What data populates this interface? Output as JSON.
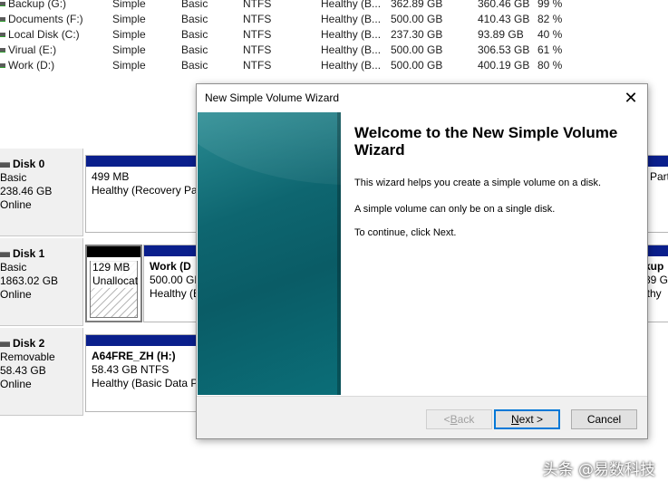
{
  "volumes": [
    {
      "name": "Backup (G:)",
      "layout": "Simple",
      "type": "Basic",
      "fs": "NTFS",
      "status": "Healthy (B...",
      "capacity": "362.89 GB",
      "free": "360.46 GB",
      "pct": "99 %"
    },
    {
      "name": "Documents (F:)",
      "layout": "Simple",
      "type": "Basic",
      "fs": "NTFS",
      "status": "Healthy (B...",
      "capacity": "500.00 GB",
      "free": "410.43 GB",
      "pct": "82 %"
    },
    {
      "name": "Local Disk (C:)",
      "layout": "Simple",
      "type": "Basic",
      "fs": "NTFS",
      "status": "Healthy (B...",
      "capacity": "237.30 GB",
      "free": "93.89 GB",
      "pct": "40 %"
    },
    {
      "name": "Virual (E:)",
      "layout": "Simple",
      "type": "Basic",
      "fs": "NTFS",
      "status": "Healthy (B...",
      "capacity": "500.00 GB",
      "free": "306.53 GB",
      "pct": "61 %"
    },
    {
      "name": "Work (D:)",
      "layout": "Simple",
      "type": "Basic",
      "fs": "NTFS",
      "status": "Healthy (B...",
      "capacity": "500.00 GB",
      "free": "400.19 GB",
      "pct": "80 %"
    }
  ],
  "disks": [
    {
      "name": "Disk 0",
      "type": "Basic",
      "size": "238.46 GB",
      "state": "Online",
      "partitions": [
        {
          "line1": "499 MB",
          "line2": "Healthy (Recovery Par"
        },
        {
          "line1": "",
          "line2": "Part"
        }
      ]
    },
    {
      "name": "Disk 1",
      "type": "Basic",
      "size": "1863.02 GB",
      "state": "Online",
      "partitions": [
        {
          "line1": "129 MB",
          "line2": "Unallocat"
        },
        {
          "title": "Work  (D",
          "line1": "500.00 GB",
          "line2": "Healthy (B"
        },
        {
          "title": "kup",
          "line1": "89 G",
          "line2": "lthy"
        }
      ]
    },
    {
      "name": "Disk 2",
      "type": "Removable",
      "size": "58.43 GB",
      "state": "Online",
      "partitions": [
        {
          "title": "A64FRE_ZH  (H:)",
          "line1": "58.43 GB NTFS",
          "line2": "Healthy (Basic Data Pa"
        }
      ]
    }
  ],
  "wizard": {
    "title": "New Simple Volume Wizard",
    "heading": "Welcome to the New Simple Volume Wizard",
    "paragraphs": [
      "This wizard helps you create a simple volume on a disk.",
      "A simple volume can only be on a single disk.",
      "To continue, click Next."
    ],
    "back_prefix": "< ",
    "back_key": "B",
    "back_rest": "ack",
    "next_prefix": "",
    "next_key": "N",
    "next_rest": "ext >",
    "cancel": "Cancel",
    "close_glyph": "✕"
  },
  "watermark": "头条 @易数科技"
}
